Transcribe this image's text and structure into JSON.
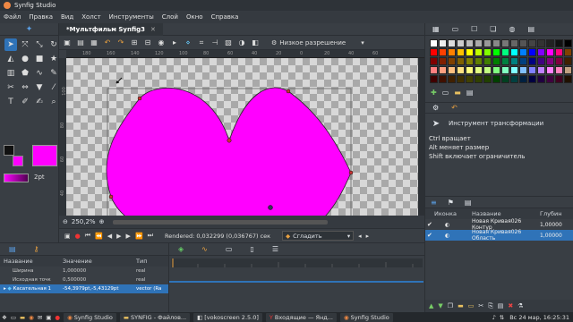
{
  "window": {
    "title": "Synfig Studio"
  },
  "menu": [
    "Файл",
    "Правка",
    "Вид",
    "Холст",
    "Инструменты",
    "Слой",
    "Окно",
    "Справка"
  ],
  "document_tab": {
    "label": "*Мультфильм Synfig3"
  },
  "canvas_toolbar": {
    "quality_label": "Низкое разрешение"
  },
  "zoom": {
    "value": "250,2%"
  },
  "status": {
    "rendered": "Rendered: 0,032299 (0,036767) сек"
  },
  "interpolation": {
    "label": "Сгладить"
  },
  "toolbox": {
    "bline_width": "2pt"
  },
  "colors": {
    "outline": "#111111",
    "fill": "#ff00ff",
    "accent": "#2f73b8"
  },
  "ruler": {
    "h_labels": [
      "180",
      "160",
      "140",
      "120",
      "100",
      "80",
      "60",
      "40",
      "20",
      "0",
      "20",
      "40",
      "60"
    ],
    "v_labels": [
      "100",
      "80",
      "60",
      "40"
    ]
  },
  "tool_info": {
    "title": "Инструмент трансформации",
    "lines": [
      "Ctrl вращает",
      "Alt меняет размер",
      "Shift включает ограничитель"
    ]
  },
  "params": {
    "headers": {
      "name": "Название",
      "value": "Значение",
      "type": "Тип"
    },
    "rows": [
      {
        "name": "Ширина",
        "value": "1,000000",
        "type": "real"
      },
      {
        "name": "Исходная точк",
        "value": "0,500000",
        "type": "real"
      },
      {
        "name": "Касательная 1",
        "value": "-54,3979pt,-5,43129pt",
        "type": "vector (Ra"
      }
    ]
  },
  "layers": {
    "headers": {
      "icon": "Иконка",
      "name": "Название",
      "depth": "Глубин"
    },
    "rows": [
      {
        "name": "Новая Кривая026 Контур",
        "value": "1,00000"
      },
      {
        "name": "Новая Кривая026 Область",
        "value": "1,00000"
      }
    ]
  },
  "palette": [
    "#ffffff",
    "#eeeeee",
    "#dddddd",
    "#cccccc",
    "#bbbbbb",
    "#aaaaaa",
    "#999999",
    "#888888",
    "#777777",
    "#666666",
    "#555555",
    "#444444",
    "#333333",
    "#222222",
    "#111111",
    "#000000",
    "#ff0000",
    "#ff4000",
    "#ff8000",
    "#ffbf00",
    "#ffff00",
    "#bfff00",
    "#80ff00",
    "#00ff00",
    "#00ff80",
    "#00ffff",
    "#0080ff",
    "#0000ff",
    "#8000ff",
    "#ff00ff",
    "#ff0080",
    "#804000",
    "#800000",
    "#802000",
    "#804000",
    "#806000",
    "#808000",
    "#608000",
    "#408000",
    "#008000",
    "#008040",
    "#008080",
    "#004080",
    "#000080",
    "#400080",
    "#800080",
    "#800040",
    "#402000",
    "#ff8080",
    "#ffa080",
    "#ffc080",
    "#ffe080",
    "#ffff80",
    "#e0ff80",
    "#c0ff80",
    "#80ff80",
    "#80ffc0",
    "#80ffff",
    "#80c0ff",
    "#8080ff",
    "#c080ff",
    "#ff80ff",
    "#ff80c0",
    "#c0a080",
    "#400000",
    "#401000",
    "#402000",
    "#403000",
    "#404000",
    "#304000",
    "#204000",
    "#004000",
    "#004020",
    "#004040",
    "#002040",
    "#000040",
    "#200040",
    "#400040",
    "#400020",
    "#201000"
  ],
  "taskbar": {
    "items": [
      "Synfig Studio",
      "SYNFIG - Файлов...",
      "[vokoscreen 2.5.0]",
      "Входящие — Янд...",
      "Synfig Studio"
    ],
    "clock": "Вс 24 мар, 16:25:31"
  }
}
